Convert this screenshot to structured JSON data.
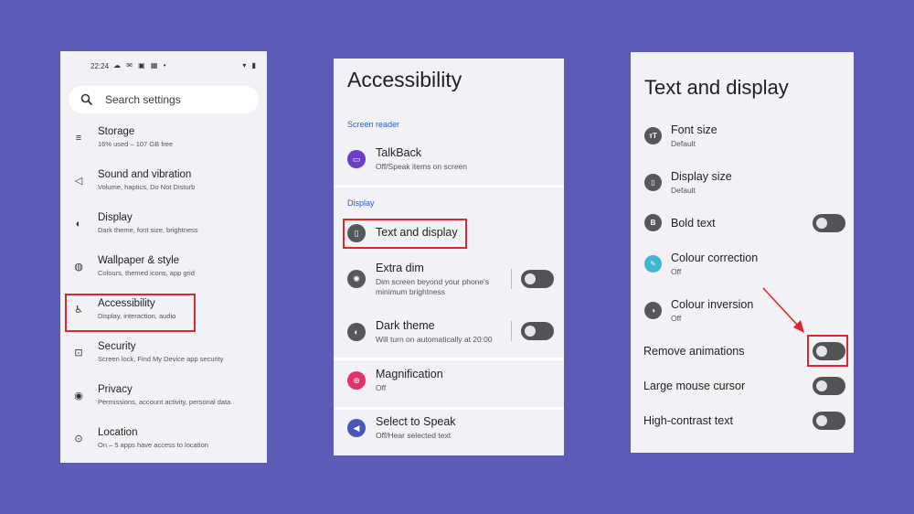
{
  "panel1": {
    "status": {
      "time": "22:24",
      "left_icons": "☁ ✉ ▣ ▦ •",
      "right_icons": "▾ ▮"
    },
    "search": {
      "placeholder": "Search settings",
      "icon": "search-icon"
    },
    "items": [
      {
        "title": "Storage",
        "subtitle": "16% used – 107 GB free",
        "icon": "storage-icon",
        "glyph": "≡"
      },
      {
        "title": "Sound and vibration",
        "subtitle": "Volume, haptics, Do Not Disturb",
        "icon": "speaker-icon",
        "glyph": "◁"
      },
      {
        "title": "Display",
        "subtitle": "Dark theme, font size, brightness",
        "icon": "brightness-icon",
        "glyph": "◐"
      },
      {
        "title": "Wallpaper & style",
        "subtitle": "Colours, themed icons, app grid",
        "icon": "palette-icon",
        "glyph": "◍"
      },
      {
        "title": "Accessibility",
        "subtitle": "Display, interaction, audio",
        "icon": "accessibility-icon",
        "glyph": "♿"
      },
      {
        "title": "Security",
        "subtitle": "Screen lock, Find My Device app security",
        "icon": "lock-icon",
        "glyph": "⊡"
      },
      {
        "title": "Privacy",
        "subtitle": "Permissions, account activity, personal data",
        "icon": "eye-icon",
        "glyph": "◉"
      },
      {
        "title": "Location",
        "subtitle": "On – 5 apps have access to location",
        "icon": "location-pin-icon",
        "glyph": "⊙"
      }
    ]
  },
  "panel2": {
    "title": "Accessibility",
    "section_screen_reader": "Screen reader",
    "section_display": "Display",
    "talkback": {
      "title": "TalkBack",
      "subtitle": "Off/Speak items on screen",
      "icon": "talkback-icon",
      "color": "#6b3fc4"
    },
    "text_display": {
      "title": "Text and display",
      "icon": "text-display-icon",
      "color": "#55575c"
    },
    "extra_dim": {
      "title": "Extra dim",
      "subtitle1": "Dim screen beyond your phone's",
      "subtitle2": "minimum brightness",
      "icon": "extra-dim-icon",
      "color": "#55575c",
      "on": false
    },
    "dark_theme": {
      "title": "Dark theme",
      "subtitle": "Will turn on automatically at 20:00",
      "icon": "dark-theme-icon",
      "color": "#55575c",
      "on": false
    },
    "magnification": {
      "title": "Magnification",
      "subtitle": "Off",
      "icon": "magnification-icon",
      "color": "#e0336b"
    },
    "select_to_speak": {
      "title": "Select to Speak",
      "subtitle": "Off/Hear selected text",
      "icon": "select-to-speak-icon",
      "color": "#4a56b8"
    }
  },
  "panel3": {
    "title": "Text and display",
    "font_size": {
      "title": "Font size",
      "subtitle": "Default",
      "icon": "font-size-icon"
    },
    "display_size": {
      "title": "Display size",
      "subtitle": "Default",
      "icon": "display-size-icon"
    },
    "bold_text": {
      "title": "Bold text",
      "icon": "bold-icon",
      "glyph": "B",
      "on": false
    },
    "colour_correction": {
      "title": "Colour correction",
      "subtitle": "Off",
      "icon": "colour-correction-icon",
      "color": "#3fb6d4"
    },
    "colour_inversion": {
      "title": "Colour inversion",
      "subtitle": "Off",
      "icon": "colour-inversion-icon"
    },
    "remove_animations": {
      "title": "Remove animations",
      "on": false
    },
    "large_mouse_cursor": {
      "title": "Large mouse cursor",
      "on": false
    },
    "high_contrast_text": {
      "title": "High-contrast text",
      "on": false
    }
  },
  "colors": {
    "background": "#5a5cb8",
    "highlight": "#e0262b",
    "section": "#2f5fbf"
  }
}
